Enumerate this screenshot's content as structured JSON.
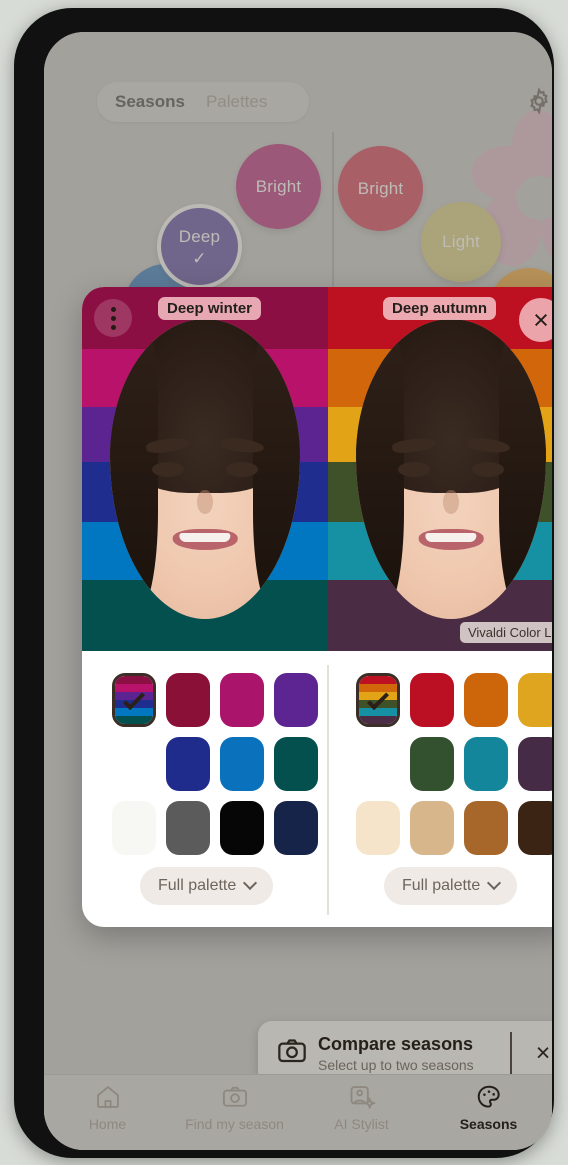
{
  "app": {
    "segmented": {
      "tabs": [
        {
          "label": "Seasons",
          "active": true
        },
        {
          "label": "Palettes",
          "active": false
        }
      ]
    },
    "settings_icon": "gear-icon"
  },
  "bubbles": [
    {
      "label": "Deep",
      "color": "#432d86",
      "selected": true,
      "check": "✓"
    },
    {
      "label": "Bright",
      "color": "#a3105d",
      "selected": false
    },
    {
      "label": "Bright",
      "color": "#bf2036",
      "selected": false
    },
    {
      "label": "Light",
      "color": "#c5b560",
      "selected": false
    }
  ],
  "modal": {
    "kebab_icon": "more-vertical-icon",
    "close_icon": "close-icon",
    "watermark": "Vivaldi Color Lab",
    "panes": [
      {
        "tag": "Deep winter",
        "stripes": [
          "#8c0f44",
          "#b8126b",
          "#5b2491",
          "#1f2d8f",
          "#0077c0",
          "#03504f"
        ],
        "swatches_multi": [
          "#8c0f44",
          "#b8126b",
          "#5b2491",
          "#1f2d8f",
          "#0077c0",
          "#03504f"
        ],
        "swatches_row1": [
          "#8a1038",
          "#ab146b",
          "#5c2591"
        ],
        "swatches_row2": [
          "#1f2c8c",
          "#0a72bd",
          "#03504f"
        ],
        "swatches_row3": [
          "#f7f7f4",
          "#5b5b5b",
          "#060606",
          "#16244a"
        ],
        "full_palette_label": "Full palette"
      },
      {
        "tag": "Deep autumn",
        "stripes": [
          "#bd1020",
          "#d2660a",
          "#e3a316",
          "#3e5129",
          "#1690a3",
          "#4a2d45"
        ],
        "swatches_multi": [
          "#bd1020",
          "#d2660a",
          "#e3a316",
          "#3e5129",
          "#1690a3",
          "#4a2d45"
        ],
        "swatches_row1": [
          "#bb1023",
          "#cd650b",
          "#e0a51e"
        ],
        "swatches_row2": [
          "#33512f",
          "#13869c",
          "#452b45"
        ],
        "swatches_row3": [
          "#f5e4c9",
          "#d7b68c",
          "#a7672a",
          "#3c2414"
        ],
        "full_palette_label": "Full palette"
      }
    ]
  },
  "snackbar": {
    "icon": "camera-icon",
    "title": "Compare seasons",
    "subtitle": "Select up to two seasons",
    "close_icon": "close-icon"
  },
  "bottom_nav": {
    "items": [
      {
        "label": "Home",
        "icon": "home-icon",
        "active": false
      },
      {
        "label": "Find my season",
        "icon": "camera-icon",
        "active": false
      },
      {
        "label": "AI Stylist",
        "icon": "ai-portrait-icon",
        "active": false
      },
      {
        "label": "Seasons",
        "icon": "palette-icon",
        "active": true
      }
    ]
  }
}
